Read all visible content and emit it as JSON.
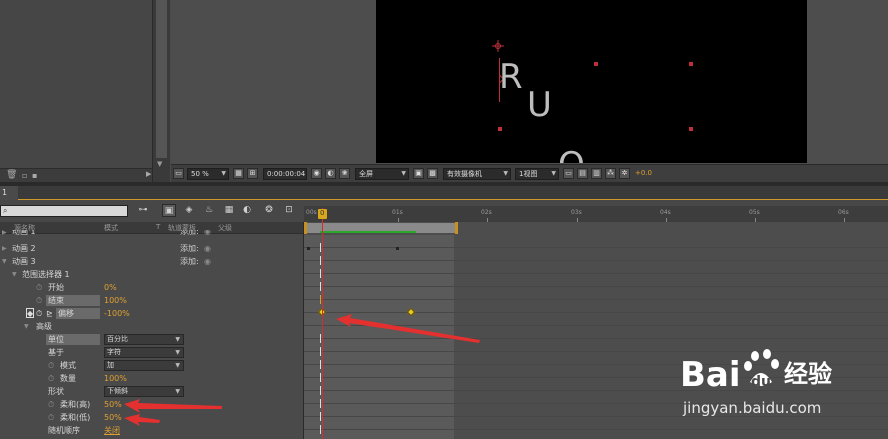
{
  "viewer": {
    "zoom": "50 %",
    "timecode": "0:00:00:04",
    "resolution": "全屏",
    "camera": "有效摄像机",
    "views": "1视图",
    "exposure": "+0.0",
    "letters": [
      "R",
      "U",
      "O"
    ]
  },
  "tab": {
    "label": "1"
  },
  "timeline": {
    "search_placeholder": "",
    "columns": [
      "源名称",
      "模式",
      "T",
      "轨道蒙板",
      "父级"
    ],
    "ruler": [
      "00s",
      "01s",
      "02s",
      "03s",
      "04s",
      "05s",
      "06s"
    ],
    "cti_label": "0"
  },
  "layers": {
    "anim1": {
      "name": "动画 1",
      "add": "添加:"
    },
    "anim2": {
      "name": "动画 2",
      "add": "添加:"
    },
    "anim3": {
      "name": "动画 3",
      "add": "添加:"
    },
    "range_selector": {
      "name": "范围选择器 1"
    },
    "start": {
      "name": "开始",
      "value": "0%"
    },
    "end": {
      "name": "结束",
      "value": "100%"
    },
    "offset": {
      "name": "偏移",
      "value": "-100%"
    },
    "advanced": {
      "name": "高级"
    },
    "units": {
      "name": "单位",
      "value": "百分比"
    },
    "based_on": {
      "name": "基于",
      "value": "字符"
    },
    "mode": {
      "name": "模式",
      "value": "加"
    },
    "amount": {
      "name": "数量",
      "value": "100%"
    },
    "shape": {
      "name": "形状",
      "value": "下倾斜"
    },
    "ease_high": {
      "name": "柔和(高)",
      "value": "50%"
    },
    "ease_low": {
      "name": "柔和(低)",
      "value": "50%"
    },
    "randomize": {
      "name": "随机顺序",
      "value": "关闭"
    }
  },
  "watermark": {
    "logo_text": "Bai",
    "logo_text2": "经验",
    "url": "jingyan.baidu.com"
  },
  "colors": {
    "accent": "#e0a030",
    "keyframe": "#e8c829",
    "playhead": "#d82b2b",
    "annotation": "#e53030"
  }
}
